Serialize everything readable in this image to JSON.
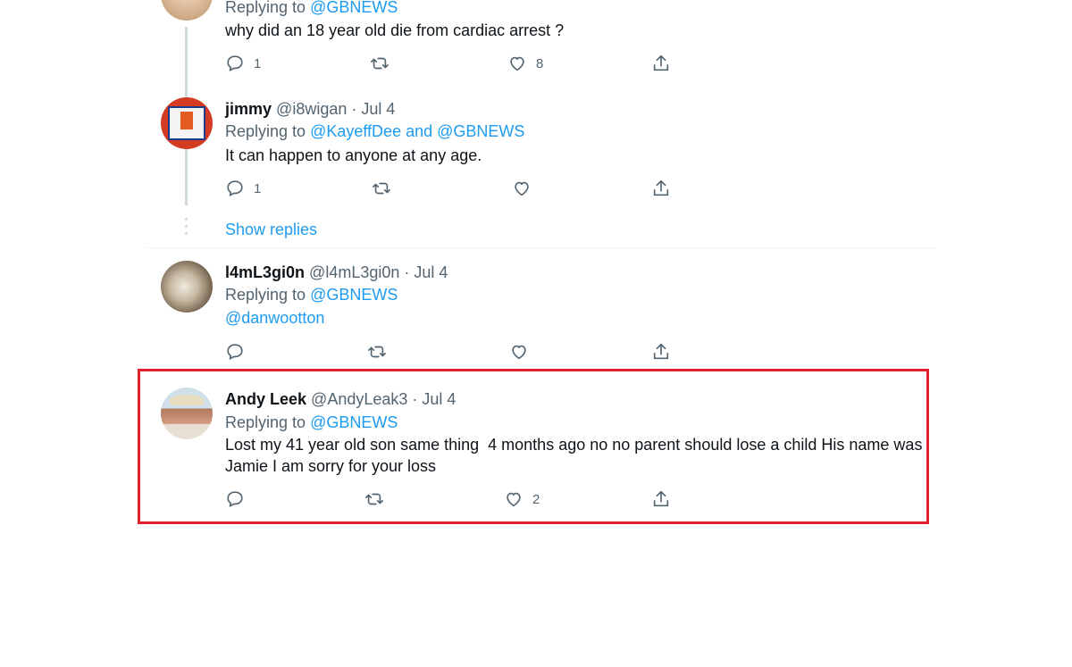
{
  "tweets": [
    {
      "name": "",
      "handle": "",
      "date": "",
      "replying_label": "Replying to",
      "replying_to": "@GBNEWS",
      "text": "why did an 18 year old die from cardiac arrest ?",
      "replies": "1",
      "retweets": "",
      "likes": "8"
    },
    {
      "name": "jimmy",
      "handle": "@i8wigan",
      "date": "· Jul 4",
      "replying_label": "Replying to",
      "replying_to": "@KayeffDee and @GBNEWS",
      "text": "It can happen to anyone at any age.",
      "replies": "1",
      "retweets": "",
      "likes": ""
    },
    {
      "name": "l4mL3gi0n",
      "handle": "@l4mL3gi0n",
      "date": "· Jul 4",
      "replying_label": "Replying to",
      "replying_to": "@GBNEWS",
      "text": "@danwootton",
      "replies": "",
      "retweets": "",
      "likes": ""
    },
    {
      "name": "Andy Leek",
      "handle": "@AndyLeak3",
      "date": "· Jul 4",
      "replying_label": "Replying to",
      "replying_to": "@GBNEWS",
      "text_line1": "Lost my 41 year old son same thing  4 months ago no no parent should lose a child His name was",
      "text_line2": "Jamie I am sorry for your loss",
      "replies": "",
      "retweets": "",
      "likes": "2"
    }
  ],
  "show_replies": "Show replies",
  "colors": {
    "link": "#1d9bf0",
    "muted": "#536471",
    "highlight": "#e0202a"
  }
}
